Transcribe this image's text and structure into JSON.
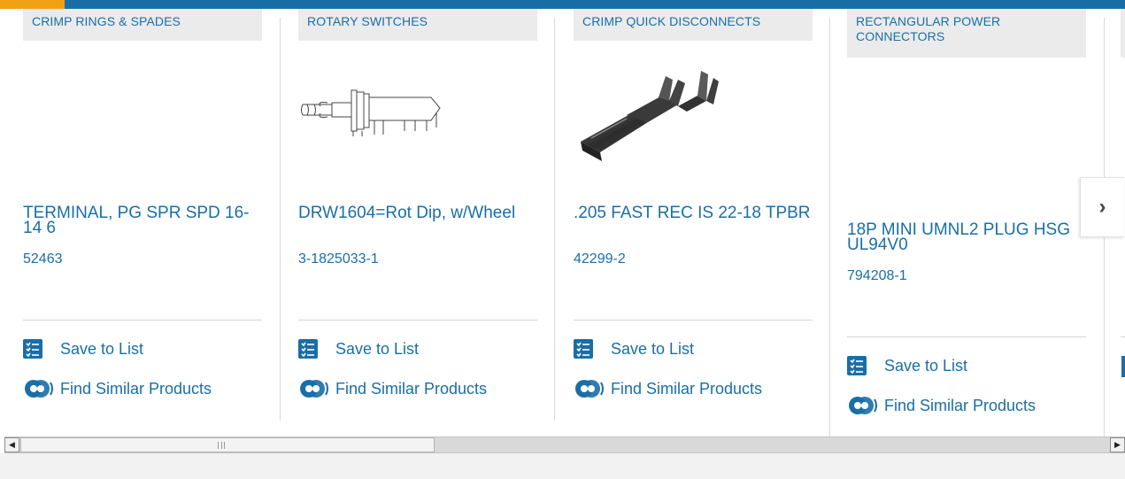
{
  "colors": {
    "brand_blue": "#1a6ea7",
    "accent_orange": "#f0a014",
    "category_bg": "#ebebeb"
  },
  "cards": [
    {
      "category": "CRIMP RINGS & SPADES",
      "title": "TERMINAL, PG SPR SPD 16-14 6",
      "part_number": "52463",
      "image": "none",
      "save_label": "Save to List",
      "similar_label": "Find Similar Products"
    },
    {
      "category": "ROTARY SWITCHES",
      "title": "DRW1604=Rot Dip, w/Wheel",
      "part_number": "3-1825033-1",
      "image": "rotary-switch-drawing",
      "save_label": "Save to List",
      "similar_label": "Find Similar Products"
    },
    {
      "category": "CRIMP QUICK DISCONNECTS",
      "title": ".205 FAST REC IS 22-18 TPBR",
      "part_number": "42299-2",
      "image": "quick-disconnect-photo",
      "save_label": "Save to List",
      "similar_label": "Find Similar Products"
    },
    {
      "category": "RECTANGULAR POWER CONNECTORS",
      "title": "18P MINI UMNL2 PLUG HSG UL94V0",
      "part_number": "794208-1",
      "image": "none",
      "save_label": "Save to List",
      "similar_label": "Find Similar Products"
    }
  ],
  "next_button": {
    "icon": "chevron-right-icon",
    "glyph": "›"
  },
  "scrollbar": {
    "left_arrow": "◀",
    "right_arrow": "▶"
  }
}
